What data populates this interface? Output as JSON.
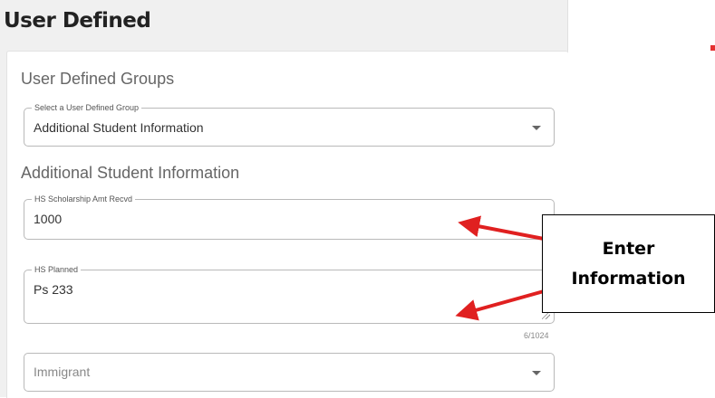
{
  "section": {
    "title": "User Defined"
  },
  "groups": {
    "heading": "User Defined Groups",
    "select_label": "Select a User Defined Group",
    "select_value": "Additional Student Information"
  },
  "info": {
    "heading": "Additional Student Information",
    "scholarship_label": "HS Scholarship Amt Recvd",
    "scholarship_value": "1000",
    "planned_label": "HS Planned",
    "planned_value": "Ps 233",
    "planned_counter": "6/1024",
    "immigrant_placeholder": "Immigrant"
  },
  "annotation": {
    "line1": "Enter",
    "line2": "Information",
    "arrow_color": "#e02020"
  },
  "icons": [
    "dropdown-caret-icon",
    "resize-handle-icon"
  ]
}
